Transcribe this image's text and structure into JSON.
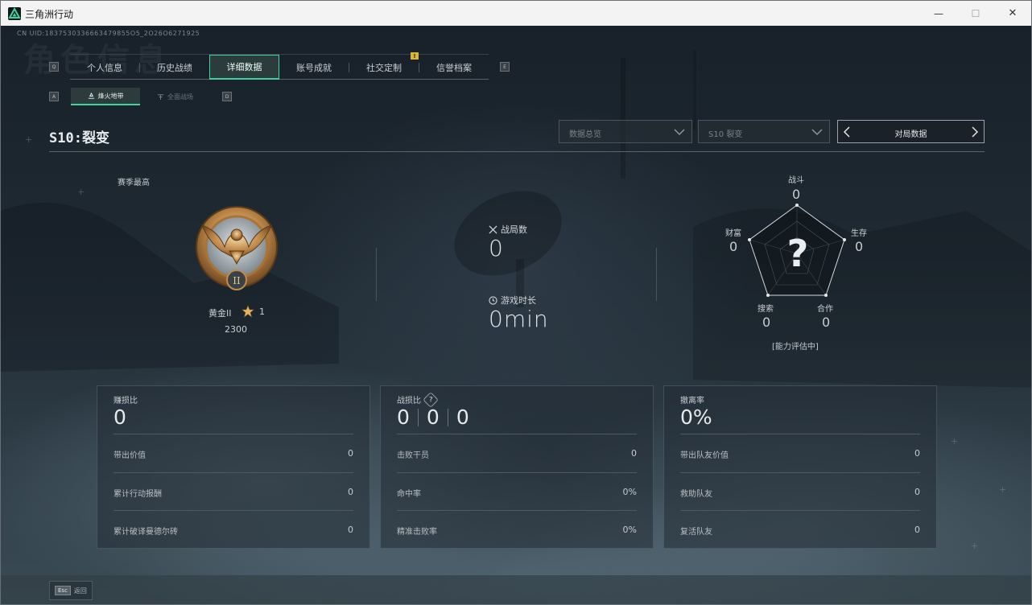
{
  "window": {
    "title": "三角洲行动",
    "controls": {
      "minimize": "—",
      "maximize": "☐",
      "close": "✕"
    }
  },
  "header": {
    "uid_text": "CN UID:1837530336663479855O5_2O26O6271925",
    "watermark_title": "角色信息",
    "tab_prev_key": "Q",
    "tab_next_key": "E",
    "tabs": [
      {
        "label": "个人信息"
      },
      {
        "label": "历史战绩"
      },
      {
        "label": "详细数据",
        "active": true
      },
      {
        "label": "账号成就"
      },
      {
        "label": "社交定制",
        "badge": "!"
      },
      {
        "label": "信誉档案"
      }
    ],
    "subtab_prev_key": "A",
    "subtab_next_key": "D",
    "subtabs": [
      {
        "label": "烽火地带",
        "active": true
      },
      {
        "label": "全面战场",
        "active": false
      }
    ]
  },
  "season": {
    "title": "S10:裂变",
    "dropdown_overview": "数据总览",
    "dropdown_season": "S10 裂变",
    "pager_label": "对局数据"
  },
  "rank": {
    "section_label": "赛季最高",
    "tier_name": "黄金II",
    "stars": "1",
    "score": "2300",
    "medal_numeral": "II"
  },
  "summary": {
    "matches_label": "战局数",
    "matches_value": "0",
    "playtime_label": "游戏时长",
    "playtime_value": "0min"
  },
  "radar": {
    "combat_label": "战斗",
    "combat_value": "0",
    "survival_label": "生存",
    "survival_value": "0",
    "cooperation_label": "合作",
    "cooperation_value": "0",
    "search_label": "搜索",
    "search_value": "0",
    "wealth_label": "财富",
    "wealth_value": "0",
    "center_mark": "?",
    "status": "[能力评估中]"
  },
  "panels": {
    "profit": {
      "title": "赚损比",
      "value": "0",
      "rows": [
        {
          "label": "带出价值",
          "value": "0"
        },
        {
          "label": "累计行动报酬",
          "value": "0"
        },
        {
          "label": "累计破译曼德尔砖",
          "value": "0"
        }
      ]
    },
    "kd": {
      "title": "战损比",
      "help_mark": "?",
      "values": [
        "0",
        "0",
        "0"
      ],
      "rows": [
        {
          "label": "击败干员",
          "value": "0"
        },
        {
          "label": "命中率",
          "value": "0%"
        },
        {
          "label": "精准击败率",
          "value": "0%"
        }
      ]
    },
    "extract": {
      "title": "撤离率",
      "value": "0%",
      "rows": [
        {
          "label": "带出队友价值",
          "value": "0"
        },
        {
          "label": "救助队友",
          "value": "0"
        },
        {
          "label": "复活队友",
          "value": "0"
        }
      ]
    }
  },
  "footer": {
    "esc_key": "Esc",
    "back_label": "返回"
  },
  "colors": {
    "accent_green": "#3fd3a0",
    "notice_yellow": "#d9b53c",
    "medal_gold": "#c08a4a"
  }
}
